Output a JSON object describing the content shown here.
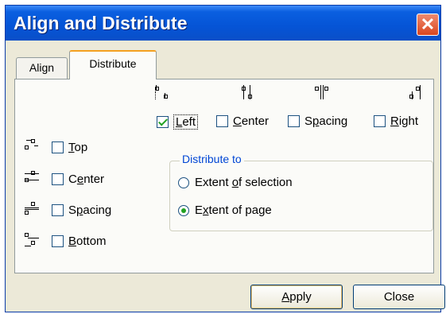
{
  "window": {
    "title": "Align and Distribute",
    "close_glyph": "✕"
  },
  "tabs": [
    {
      "label": "Align",
      "selected": false
    },
    {
      "label": "Distribute",
      "selected": true
    }
  ],
  "horizontal_options": [
    {
      "mn": "L",
      "rest": "eft",
      "pre": "",
      "checked": true,
      "icon": "distribute-left-icon"
    },
    {
      "mn": "C",
      "rest": "enter",
      "pre": "",
      "checked": false,
      "icon": "distribute-center-h-icon"
    },
    {
      "mn": "p",
      "rest": "acing",
      "pre": "S",
      "checked": false,
      "icon": "distribute-spacing-h-icon"
    },
    {
      "mn": "R",
      "rest": "ight",
      "pre": "",
      "checked": false,
      "icon": "distribute-right-icon"
    }
  ],
  "vertical_options": [
    {
      "mn": "T",
      "rest": "op",
      "pre": "",
      "checked": false,
      "icon": "distribute-top-icon"
    },
    {
      "mn": "e",
      "rest": "nter",
      "pre": "C",
      "checked": false,
      "icon": "distribute-center-v-icon"
    },
    {
      "mn": "p",
      "rest": "acing",
      "pre": "S",
      "checked": false,
      "icon": "distribute-spacing-v-icon"
    },
    {
      "mn": "B",
      "rest": "ottom",
      "pre": "",
      "checked": false,
      "icon": "distribute-bottom-icon"
    }
  ],
  "distribute_to": {
    "legend": "Distribute to",
    "options": [
      {
        "pre": "Extent ",
        "mn": "o",
        "rest": "f selection",
        "selected": false
      },
      {
        "pre": "E",
        "mn": "x",
        "rest": "tent of page",
        "selected": true
      }
    ]
  },
  "buttons": {
    "apply": {
      "mn": "A",
      "rest": "pply"
    },
    "close": {
      "label": "Close"
    }
  },
  "colors": {
    "title_bar": "#0554d6",
    "dialog_bg": "#ece9d8",
    "check_mark": "#21a121",
    "group_legend": "#0046d5"
  }
}
